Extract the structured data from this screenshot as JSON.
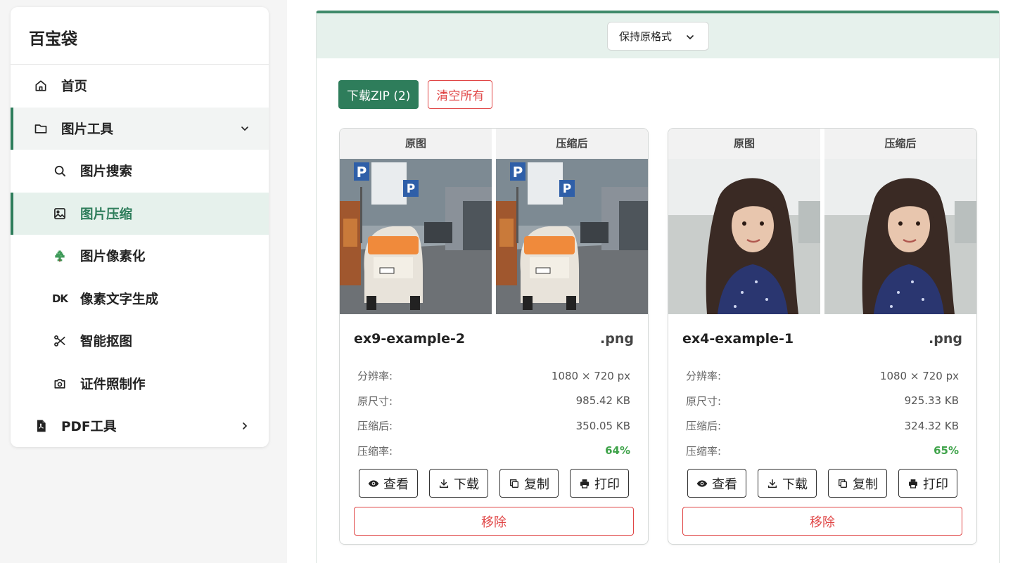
{
  "sidebar": {
    "brand": "百宝袋",
    "items": [
      {
        "label": "首页",
        "icon": "home-icon"
      },
      {
        "label": "图片工具",
        "icon": "folder-icon",
        "expanded": true
      },
      {
        "label": "图片搜索",
        "icon": "search-icon"
      },
      {
        "label": "图片压缩",
        "icon": "image-icon",
        "active": true
      },
      {
        "label": "图片像素化",
        "icon": "pixel-tree-icon"
      },
      {
        "label": "像素文字生成",
        "icon": "dk-icon",
        "icon_text": "DK"
      },
      {
        "label": "智能抠图",
        "icon": "scissors-icon"
      },
      {
        "label": "证件照制作",
        "icon": "camera-icon"
      },
      {
        "label": "PDF工具",
        "icon": "pdf-file-icon"
      }
    ]
  },
  "toolbar": {
    "format_select": "保持原格式",
    "download_zip": "下载ZIP (2)",
    "clear_all": "清空所有"
  },
  "labels": {
    "original": "原图",
    "compressed": "压缩后",
    "resolution": "分辨率:",
    "original_size": "原尺寸:",
    "compressed_size": "压缩后:",
    "ratio": "压缩率:",
    "view": "查看",
    "download": "下载",
    "copy": "复制",
    "print": "打印",
    "remove": "移除"
  },
  "cards": [
    {
      "name": "ex9-example-2",
      "ext": ".png",
      "resolution": "1080 × 720 px",
      "original_size": "985.42 KB",
      "compressed_size": "350.05 KB",
      "ratio": "64%"
    },
    {
      "name": "ex4-example-1",
      "ext": ".png",
      "resolution": "1080 × 720 px",
      "original_size": "925.33 KB",
      "compressed_size": "324.32 KB",
      "ratio": "65%"
    }
  ],
  "colors": {
    "accent": "#2e7d5b",
    "danger": "#e04545",
    "success": "#3fa34a",
    "header_tint": "#e6f1ec"
  }
}
